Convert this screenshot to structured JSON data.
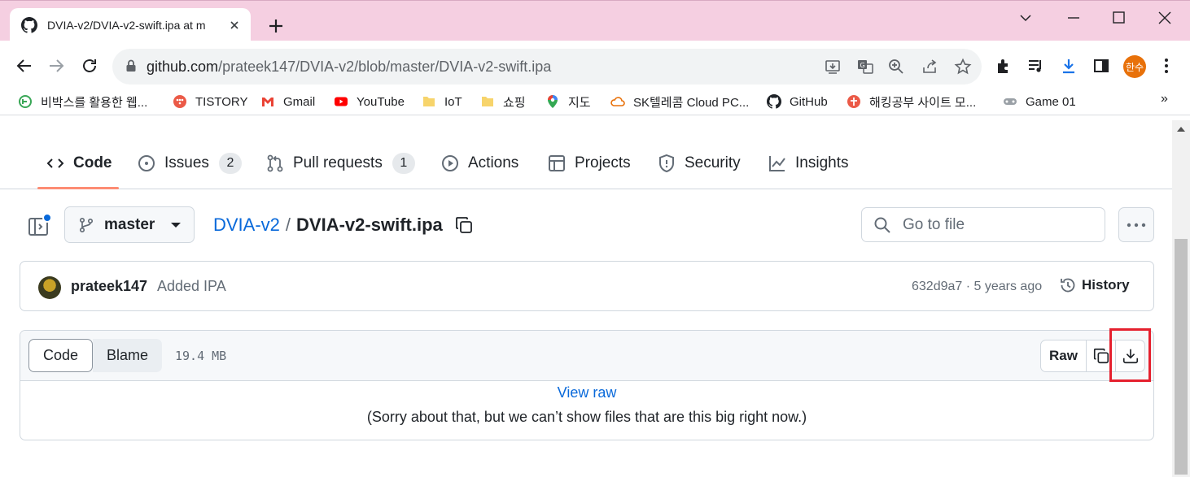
{
  "browser": {
    "tab_title": "DVIA-v2/DVIA-v2-swift.ipa at m",
    "url_host": "github.com",
    "url_path": "/prateek147/DVIA-v2/blob/master/DVIA-v2-swift.ipa",
    "profile_label": "한수",
    "bookmarks": [
      {
        "label": "비박스를 활용한 웹...",
        "icon": "bwapp-icon"
      },
      {
        "label": "TISTORY",
        "icon": "tistory-icon"
      },
      {
        "label": "Gmail",
        "icon": "gmail-icon"
      },
      {
        "label": "YouTube",
        "icon": "youtube-icon"
      },
      {
        "label": "IoT",
        "icon": "folder-icon"
      },
      {
        "label": "쇼핑",
        "icon": "folder-icon"
      },
      {
        "label": "지도",
        "icon": "maps-icon"
      },
      {
        "label": "SK텔레콤 Cloud PC...",
        "icon": "cloud-icon"
      },
      {
        "label": "GitHub",
        "icon": "github-icon"
      },
      {
        "label": "해킹공부 사이트 모...",
        "icon": "site-icon"
      },
      {
        "label": "Game 01",
        "icon": "gamepad-icon"
      }
    ],
    "bookmarks_overflow": "»"
  },
  "repo_nav": {
    "items": [
      {
        "label": "Code",
        "icon": "code-icon"
      },
      {
        "label": "Issues",
        "icon": "issue-icon",
        "count": "2"
      },
      {
        "label": "Pull requests",
        "icon": "pull-request-icon",
        "count": "1"
      },
      {
        "label": "Actions",
        "icon": "play-icon"
      },
      {
        "label": "Projects",
        "icon": "table-icon"
      },
      {
        "label": "Security",
        "icon": "shield-icon"
      },
      {
        "label": "Insights",
        "icon": "graph-icon"
      }
    ]
  },
  "file_nav": {
    "branch": "master",
    "repo_name": "DVIA-v2",
    "separator": "/",
    "file_name": "DVIA-v2-swift.ipa",
    "go_to_file_placeholder": "Go to file"
  },
  "commit": {
    "author": "prateek147",
    "message": "Added IPA",
    "sha_time": "632d9a7 · 5 years ago",
    "history_label": "History"
  },
  "file": {
    "tab_code": "Code",
    "tab_blame": "Blame",
    "size": "19.4 MB",
    "raw_label": "Raw",
    "view_raw": "View raw",
    "too_big_msg": "(Sorry about that, but we can’t show files that are this big right now.)"
  },
  "colors": {
    "accent_link": "#0969da",
    "active_tab_underline": "#fd8c73",
    "highlight_box": "#e5202e",
    "chrome_tabbar": "#f5cfe1"
  }
}
